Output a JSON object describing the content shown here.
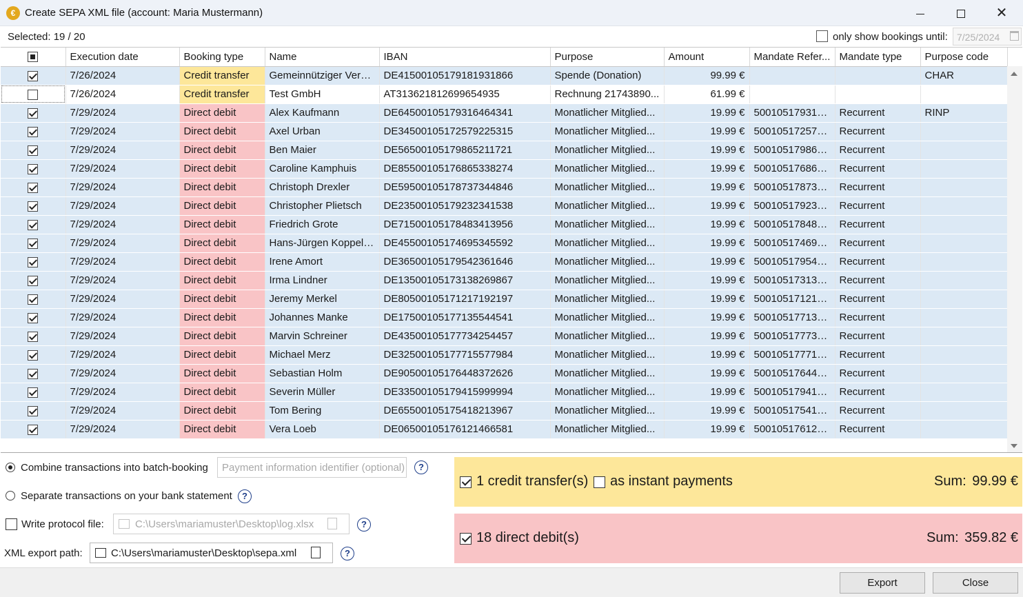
{
  "window": {
    "title": "Create SEPA XML file (account: Maria Mustermann)",
    "app_icon": "€"
  },
  "toolbar": {
    "selected_text": "Selected: 19 / 20",
    "filter_label": "only show bookings until:",
    "filter_date": "7/25/2024"
  },
  "table": {
    "headers": [
      "Execution date",
      "Booking type",
      "Name",
      "IBAN",
      "Purpose",
      "Amount",
      "Mandate Refer...",
      "Mandate type",
      "Purpose code"
    ],
    "rows": [
      {
        "checked": true,
        "date": "7/26/2024",
        "type": "Credit transfer",
        "name": "Gemeinnütziger Verei...",
        "iban": "DE41500105179181931866",
        "purpose": "Spende (Donation)",
        "amount": "99.99 €",
        "mandate_ref": "",
        "mandate_type": "",
        "purpose_code": "CHAR"
      },
      {
        "checked": false,
        "date": "7/26/2024",
        "type": "Credit transfer",
        "name": "Test GmbH",
        "iban": "AT313621812699654935",
        "purpose": "Rechnung 21743890...",
        "amount": "61.99 €",
        "mandate_ref": "",
        "mandate_type": "",
        "purpose_code": ""
      },
      {
        "checked": true,
        "date": "7/29/2024",
        "type": "Direct debit",
        "name": "Alex Kaufmann",
        "iban": "DE64500105179316464341",
        "purpose": "Monatlicher Mitglied...",
        "amount": "19.99 €",
        "mandate_ref": "500105179316...",
        "mandate_type": "Recurrent",
        "purpose_code": "RINP"
      },
      {
        "checked": true,
        "date": "7/29/2024",
        "type": "Direct debit",
        "name": "Axel Urban",
        "iban": "DE34500105172579225315",
        "purpose": "Monatlicher Mitglied...",
        "amount": "19.99 €",
        "mandate_ref": "500105172579...",
        "mandate_type": "Recurrent",
        "purpose_code": ""
      },
      {
        "checked": true,
        "date": "7/29/2024",
        "type": "Direct debit",
        "name": "Ben Maier",
        "iban": "DE56500105179865211721",
        "purpose": "Monatlicher Mitglied...",
        "amount": "19.99 €",
        "mandate_ref": "500105179865...",
        "mandate_type": "Recurrent",
        "purpose_code": ""
      },
      {
        "checked": true,
        "date": "7/29/2024",
        "type": "Direct debit",
        "name": "Caroline Kamphuis",
        "iban": "DE85500105176865338274",
        "purpose": "Monatlicher Mitglied...",
        "amount": "19.99 €",
        "mandate_ref": "500105176865...",
        "mandate_type": "Recurrent",
        "purpose_code": ""
      },
      {
        "checked": true,
        "date": "7/29/2024",
        "type": "Direct debit",
        "name": "Christoph Drexler",
        "iban": "DE59500105178737344846",
        "purpose": "Monatlicher Mitglied...",
        "amount": "19.99 €",
        "mandate_ref": "500105178737...",
        "mandate_type": "Recurrent",
        "purpose_code": ""
      },
      {
        "checked": true,
        "date": "7/29/2024",
        "type": "Direct debit",
        "name": "Christopher Plietsch",
        "iban": "DE23500105179232341538",
        "purpose": "Monatlicher Mitglied...",
        "amount": "19.99 €",
        "mandate_ref": "500105179232...",
        "mandate_type": "Recurrent",
        "purpose_code": ""
      },
      {
        "checked": true,
        "date": "7/29/2024",
        "type": "Direct debit",
        "name": "Friedrich Grote",
        "iban": "DE71500105178483413956",
        "purpose": "Monatlicher Mitglied...",
        "amount": "19.99 €",
        "mandate_ref": "500105178483...",
        "mandate_type": "Recurrent",
        "purpose_code": ""
      },
      {
        "checked": true,
        "date": "7/29/2024",
        "type": "Direct debit",
        "name": "Hans-Jürgen Koppelk...",
        "iban": "DE45500105174695345592",
        "purpose": "Monatlicher Mitglied...",
        "amount": "19.99 €",
        "mandate_ref": "500105174695...",
        "mandate_type": "Recurrent",
        "purpose_code": ""
      },
      {
        "checked": true,
        "date": "7/29/2024",
        "type": "Direct debit",
        "name": "Irene Amort",
        "iban": "DE36500105179542361646",
        "purpose": "Monatlicher Mitglied...",
        "amount": "19.99 €",
        "mandate_ref": "500105179542...",
        "mandate_type": "Recurrent",
        "purpose_code": ""
      },
      {
        "checked": true,
        "date": "7/29/2024",
        "type": "Direct debit",
        "name": "Irma Lindner",
        "iban": "DE13500105173138269867",
        "purpose": "Monatlicher Mitglied...",
        "amount": "19.99 €",
        "mandate_ref": "500105173138...",
        "mandate_type": "Recurrent",
        "purpose_code": ""
      },
      {
        "checked": true,
        "date": "7/29/2024",
        "type": "Direct debit",
        "name": "Jeremy Merkel",
        "iban": "DE80500105171217192197",
        "purpose": "Monatlicher Mitglied...",
        "amount": "19.99 €",
        "mandate_ref": "500105171217...",
        "mandate_type": "Recurrent",
        "purpose_code": ""
      },
      {
        "checked": true,
        "date": "7/29/2024",
        "type": "Direct debit",
        "name": "Johannes Manke",
        "iban": "DE17500105177135544541",
        "purpose": "Monatlicher Mitglied...",
        "amount": "19.99 €",
        "mandate_ref": "500105177135...",
        "mandate_type": "Recurrent",
        "purpose_code": ""
      },
      {
        "checked": true,
        "date": "7/29/2024",
        "type": "Direct debit",
        "name": "Marvin Schreiner",
        "iban": "DE43500105177734254457",
        "purpose": "Monatlicher Mitglied...",
        "amount": "19.99 €",
        "mandate_ref": "500105177734...",
        "mandate_type": "Recurrent",
        "purpose_code": ""
      },
      {
        "checked": true,
        "date": "7/29/2024",
        "type": "Direct debit",
        "name": "Michael Merz",
        "iban": "DE32500105177715577984",
        "purpose": "Monatlicher Mitglied...",
        "amount": "19.99 €",
        "mandate_ref": "500105177715...",
        "mandate_type": "Recurrent",
        "purpose_code": ""
      },
      {
        "checked": true,
        "date": "7/29/2024",
        "type": "Direct debit",
        "name": "Sebastian Holm",
        "iban": "DE90500105176448372626",
        "purpose": "Monatlicher Mitglied...",
        "amount": "19.99 €",
        "mandate_ref": "500105176448...",
        "mandate_type": "Recurrent",
        "purpose_code": ""
      },
      {
        "checked": true,
        "date": "7/29/2024",
        "type": "Direct debit",
        "name": "Severin Müller",
        "iban": "DE33500105179415999994",
        "purpose": "Monatlicher Mitglied...",
        "amount": "19.99 €",
        "mandate_ref": "500105179415...",
        "mandate_type": "Recurrent",
        "purpose_code": ""
      },
      {
        "checked": true,
        "date": "7/29/2024",
        "type": "Direct debit",
        "name": "Tom Bering",
        "iban": "DE65500105175418213967",
        "purpose": "Monatlicher Mitglied...",
        "amount": "19.99 €",
        "mandate_ref": "500105175418...",
        "mandate_type": "Recurrent",
        "purpose_code": ""
      },
      {
        "checked": true,
        "date": "7/29/2024",
        "type": "Direct debit",
        "name": "Vera Loeb",
        "iban": "DE06500105176121466581",
        "purpose": "Monatlicher Mitglied...",
        "amount": "19.99 €",
        "mandate_ref": "500105176121...",
        "mandate_type": "Recurrent",
        "purpose_code": ""
      }
    ]
  },
  "options": {
    "batch_label": "Combine transactions into batch-booking",
    "batch_placeholder": "Payment information identifier (optional)",
    "separate_label": "Separate transactions on your bank statement",
    "protocol_label": "Write protocol file:",
    "protocol_path": "C:\\Users\\mariamuster\\Desktop\\log.xlsx",
    "xml_label": "XML export path:",
    "xml_path": "C:\\Users\\mariamuster\\Desktop\\sepa.xml",
    "help_glyph": "?"
  },
  "summary": {
    "credit_label": "1 credit transfer(s)",
    "instant_label": "as instant payments",
    "credit_sum_label": "Sum:",
    "credit_sum": "99.99 €",
    "debit_label": "18 direct debit(s)",
    "debit_sum_label": "Sum:",
    "debit_sum": "359.82 €"
  },
  "buttons": {
    "export": "Export",
    "close": "Close"
  },
  "colors": {
    "credit_transfer": "#fde79a",
    "direct_debit": "#f9c4c6",
    "selected_row": "#dce9f5",
    "app_icon": "#e3a81e"
  }
}
